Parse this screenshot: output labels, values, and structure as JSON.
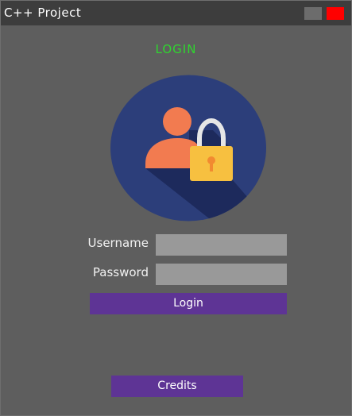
{
  "window": {
    "title": "C++ Project",
    "colors": {
      "minimize": "#6c6c6c",
      "close": "#ff0000"
    }
  },
  "login": {
    "heading": "LOGIN",
    "heading_color": "#2fd62f",
    "avatar_icon": "user-lock-icon",
    "username_label": "Username",
    "username_value": "",
    "password_label": "Password",
    "password_value": "",
    "login_button": "Login"
  },
  "footer": {
    "credits_button": "Credits"
  },
  "colors": {
    "background": "#5e5e5e",
    "titlebar": "#3d3d3d",
    "button": "#5e3495",
    "input": "#999999"
  }
}
